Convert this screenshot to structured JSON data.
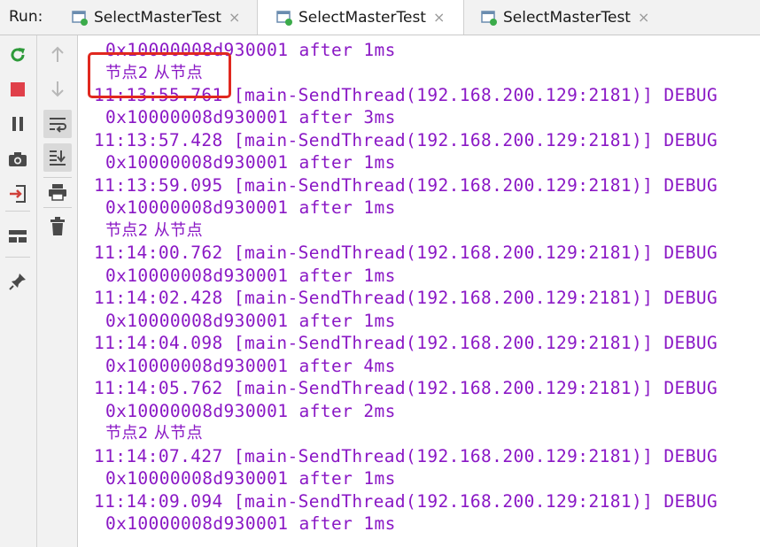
{
  "run_label": "Run:",
  "tabs": [
    {
      "label": "SelectMasterTest",
      "close": "×"
    },
    {
      "label": "SelectMasterTest",
      "close": "×"
    },
    {
      "label": "SelectMasterTest",
      "close": "×"
    }
  ],
  "toolbar_left": [
    "rerun-icon",
    "stop-icon",
    "pause-icon",
    "camera-icon",
    "login-icon",
    "layout-icon",
    "pin-icon"
  ],
  "toolbar_mid": [
    "up-arrow-icon",
    "down-arrow-icon",
    "soft-wrap-icon",
    "scroll-to-end-icon",
    "print-icon",
    "trash-icon"
  ],
  "colors": {
    "console_text": "#8a18c5",
    "highlight": "#e0281f",
    "rerun": "#2e9a3a",
    "stop": "#e0404a"
  },
  "console": {
    "lines": [
      "0x10000008d930001 after 1ms",
      "节点2 从节点",
      "11:13:55.761 [main-SendThread(192.168.200.129:2181)] DEBUG",
      "0x10000008d930001 after 3ms",
      "11:13:57.428 [main-SendThread(192.168.200.129:2181)] DEBUG",
      "0x10000008d930001 after 1ms",
      "11:13:59.095 [main-SendThread(192.168.200.129:2181)] DEBUG",
      "0x10000008d930001 after 1ms",
      "节点2 从节点",
      "11:14:00.762 [main-SendThread(192.168.200.129:2181)] DEBUG",
      "0x10000008d930001 after 1ms",
      "11:14:02.428 [main-SendThread(192.168.200.129:2181)] DEBUG",
      "0x10000008d930001 after 1ms",
      "11:14:04.098 [main-SendThread(192.168.200.129:2181)] DEBUG",
      "0x10000008d930001 after 4ms",
      "11:14:05.762 [main-SendThread(192.168.200.129:2181)] DEBUG",
      "0x10000008d930001 after 2ms",
      "节点2 从节点",
      "11:14:07.427 [main-SendThread(192.168.200.129:2181)] DEBUG",
      "0x10000008d930001 after 1ms",
      "11:14:09.094 [main-SendThread(192.168.200.129:2181)] DEBUG",
      "0x10000008d930001 after 1ms"
    ]
  }
}
